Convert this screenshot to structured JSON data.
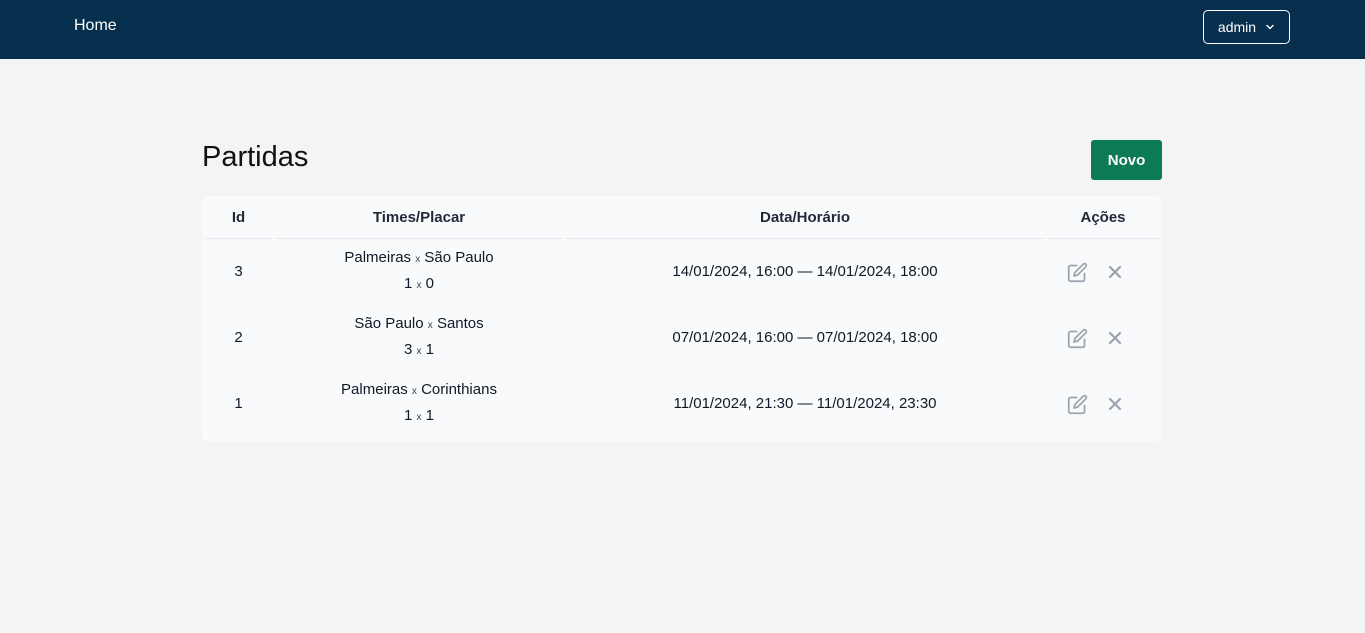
{
  "nav": {
    "home_label": "Home",
    "user_label": "admin"
  },
  "page": {
    "title": "Partidas",
    "new_button_label": "Novo"
  },
  "table": {
    "headers": [
      "Id",
      "Times/Placar",
      "Data/Horário",
      "Ações"
    ],
    "rows": [
      {
        "id": "3",
        "home_team": "Palmeiras",
        "away_team": "São Paulo",
        "home_score": "1",
        "away_score": "0",
        "datetime": "14/01/2024, 16:00 — 14/01/2024, 18:00"
      },
      {
        "id": "2",
        "home_team": "São Paulo",
        "away_team": "Santos",
        "home_score": "3",
        "away_score": "1",
        "datetime": "07/01/2024, 16:00 — 07/01/2024, 18:00"
      },
      {
        "id": "1",
        "home_team": "Palmeiras",
        "away_team": "Corinthians",
        "home_score": "1",
        "away_score": "1",
        "datetime": "11/01/2024, 21:30 — 11/01/2024, 23:30"
      }
    ],
    "separator": "x"
  },
  "colors": {
    "navbar": "#06304d",
    "primary_button": "#0b7a55",
    "icon_gray": "#9ca3af"
  },
  "icons": {
    "edit": "edit-icon",
    "delete": "close-icon",
    "dropdown": "chevron-down-icon"
  }
}
